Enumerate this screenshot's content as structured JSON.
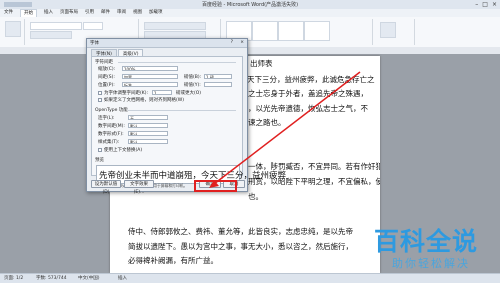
{
  "window": {
    "title": "百度经验 - Microsoft Word(产品激活失败)"
  },
  "menubar": {
    "items": [
      "文件",
      "开始",
      "插入",
      "页面布局",
      "引用",
      "邮件",
      "审阅",
      "视图",
      "加载项"
    ]
  },
  "document": {
    "lines": [
      "出师表",
      "天下三分，益州疲弊，此诚危急存亡之",
      "之士忘身于外者，盖追先帝之殊遇，",
      "，以光先帝遗德，恢弘志士之气，不",
      "谏之路也。",
      "一体，陟罚臧否，不宜异同。若有作奸犯科及为忠善",
      "刑赏，以昭陛下平明之理，不宜偏私，使内外异法",
      "也。",
      "侍中、侍郎郭攸之、费祎、董允等，此皆良实，志虑忠纯，是以先帝",
      "简拔以遗陛下。愚以为宫中之事，事无大小，悉以咨之，然后施行，",
      "必得裨补阙漏，有所广益。"
    ]
  },
  "statusbar": {
    "page": "页面: 1/2",
    "words": "字数: 573/744",
    "lang": "中文(中国)",
    "mode": "插入"
  },
  "dialog": {
    "title": "字体",
    "tabs": [
      "字体(N)",
      "高级(V)"
    ],
    "section_spacing": "字符间距",
    "scale_label": "缩放(C):",
    "scale_value": "100%",
    "spacing_label": "间距(S):",
    "spacing_value": "加宽",
    "spacing_by_label": "磅值(B):",
    "spacing_by_value": "1 磅",
    "position_label": "位置(P):",
    "position_value": "标准",
    "position_by_label": "磅值(Y):",
    "kerning_label": "为字体调整字间距(K):",
    "kerning_value": "1",
    "kerning_unit": "磅或更大(O)",
    "grid_label": "如果定义了文档网格，则对齐到网格(W)",
    "section_opentype": "OpenType 功能",
    "ligature_label": "连字(L):",
    "ligature_value": "无",
    "numspacing_label": "数字间距(M):",
    "numspacing_value": "默认",
    "numform_label": "数字形式(F):",
    "numform_value": "默认",
    "style_label": "样式集(T):",
    "style_value": "默认",
    "context_label": "使用上下文替换(A)",
    "preview_label": "预览",
    "preview_text": "先帝创业未半而中道崩殂，今天下三分，益州疲弊",
    "note": "这是一种 TrueType 字体，同时适用于屏幕和打印机。",
    "default_button": "设为默认值(D)",
    "effects_button": "文字效果(E)...",
    "ok_button": "确定",
    "cancel_button": "取消"
  },
  "watermark": {
    "main": "百科全说",
    "sub": "助你轻松解决"
  },
  "colors": {
    "highlight": "#e02020",
    "watermark": "#2e9ae0"
  }
}
